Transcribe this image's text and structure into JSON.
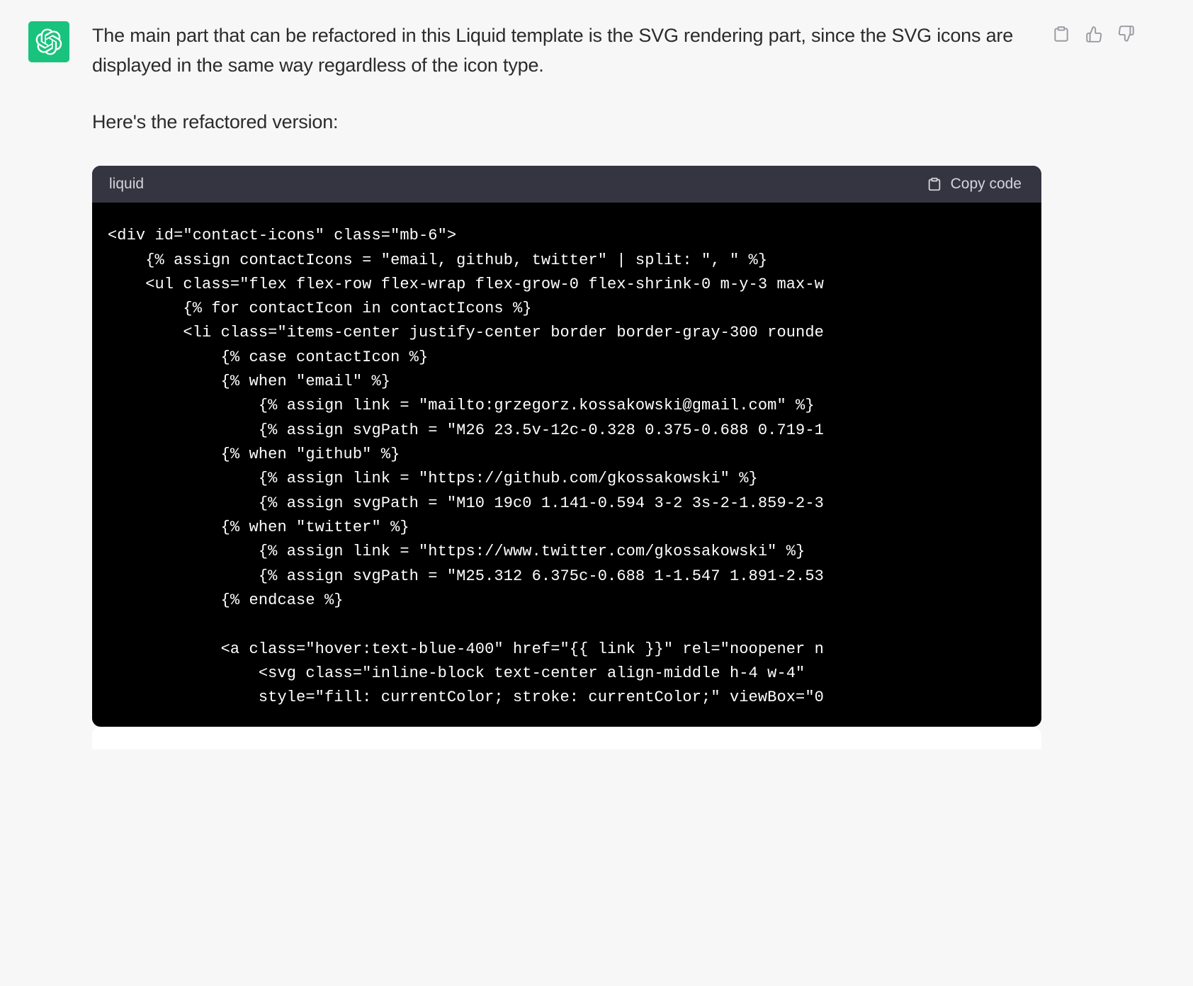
{
  "message": {
    "intro": "The main part that can be refactored in this Liquid template is the SVG rendering part, since the SVG icons are displayed in the same way regardless of the icon type.",
    "subtext": "Here's the refactored version:"
  },
  "codeblock": {
    "language": "liquid",
    "copy_label": "Copy code",
    "code": "<div id=\"contact-icons\" class=\"mb-6\">\n    {% assign contactIcons = \"email, github, twitter\" | split: \", \" %}\n    <ul class=\"flex flex-row flex-wrap flex-grow-0 flex-shrink-0 m-y-3 max-w\n        {% for contactIcon in contactIcons %}\n        <li class=\"items-center justify-center border border-gray-300 rounde\n            {% case contactIcon %}\n            {% when \"email\" %}\n                {% assign link = \"mailto:grzegorz.kossakowski@gmail.com\" %}\n                {% assign svgPath = \"M26 23.5v-12c-0.328 0.375-0.688 0.719-1\n            {% when \"github\" %}\n                {% assign link = \"https://github.com/gkossakowski\" %}\n                {% assign svgPath = \"M10 19c0 1.141-0.594 3-2 3s-2-1.859-2-3\n            {% when \"twitter\" %}\n                {% assign link = \"https://www.twitter.com/gkossakowski\" %}\n                {% assign svgPath = \"M25.312 6.375c-0.688 1-1.547 1.891-2.53\n            {% endcase %}\n\n            <a class=\"hover:text-blue-400\" href=\"{{ link }}\" rel=\"noopener n\n                <svg class=\"inline-block text-center align-middle h-4 w-4\"\n                style=\"fill: currentColor; stroke: currentColor;\" viewBox=\"0"
  },
  "icons": {
    "avatar": "assistant-logo-icon",
    "clipboard": "clipboard-icon",
    "thumbs_up": "thumbs-up-icon",
    "thumbs_down": "thumbs-down-icon"
  }
}
